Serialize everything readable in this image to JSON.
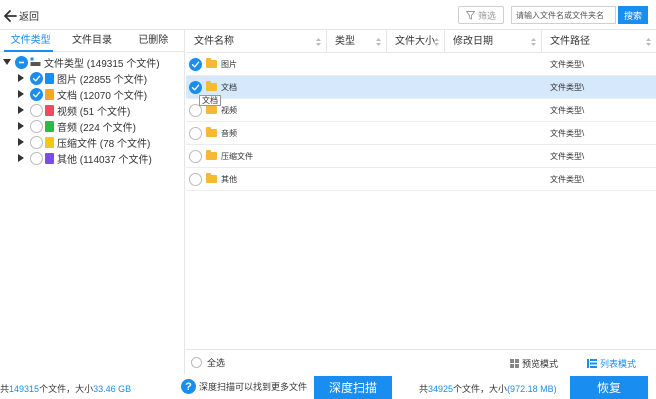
{
  "topbar": {
    "back_label": "返回",
    "filter_label": "筛选",
    "search_placeholder": "请输入文件名或文件夹名",
    "search_button": "搜索"
  },
  "left_tabs": [
    "文件类型",
    "文件目录",
    "已删除"
  ],
  "tree": {
    "root_label": "文件类型 (149315 个文件)",
    "items": [
      {
        "label": "图片 (22855 个文件)",
        "checked": true,
        "color": "#1a8df0",
        "icon": "image-icon"
      },
      {
        "label": "文档 (12070 个文件)",
        "checked": true,
        "color": "#f5a623",
        "icon": "document-icon"
      },
      {
        "label": "视频 (51 个文件)",
        "checked": false,
        "color": "#f04a5e",
        "icon": "video-icon"
      },
      {
        "label": "音频 (224 个文件)",
        "checked": false,
        "color": "#2db84c",
        "icon": "audio-icon"
      },
      {
        "label": "压缩文件 (78 个文件)",
        "checked": false,
        "color": "#f5c518",
        "icon": "archive-icon"
      },
      {
        "label": "其他 (114037 个文件)",
        "checked": false,
        "color": "#7a4de8",
        "icon": "other-file-icon"
      }
    ]
  },
  "table": {
    "columns": [
      "文件名称",
      "类型",
      "文件大小",
      "修改日期",
      "文件路径"
    ],
    "rows": [
      {
        "name": "图片",
        "path": "文件类型\\",
        "checked": true,
        "selected": false
      },
      {
        "name": "文档",
        "path": "文件类型\\",
        "checked": true,
        "selected": true
      },
      {
        "name": "视频",
        "path": "文件类型\\",
        "checked": false,
        "selected": false
      },
      {
        "name": "音频",
        "path": "文件类型\\",
        "checked": false,
        "selected": false
      },
      {
        "name": "压缩文件",
        "path": "文件类型\\",
        "checked": false,
        "selected": false
      },
      {
        "name": "其他",
        "path": "文件类型\\",
        "checked": false,
        "selected": false
      }
    ],
    "tooltip": "文档"
  },
  "footer": {
    "select_all": "全选",
    "preview_mode": "预览模式",
    "list_mode": "列表模式"
  },
  "status": {
    "left_prefix": "共",
    "left_count": "149315",
    "left_mid": "个文件，大小",
    "left_size": "33.46 GB",
    "help_text": "深度扫描可以找到更多文件",
    "deep_scan": "深度扫描",
    "right_prefix": "共",
    "right_count": "34925",
    "right_mid": "个文件，大小",
    "right_size": "(972.18 MB)",
    "recover": "恢复"
  },
  "colors": {
    "accent": "#1a8df0",
    "selected_row": "#d6e8fb",
    "folder": "#f5b935"
  }
}
